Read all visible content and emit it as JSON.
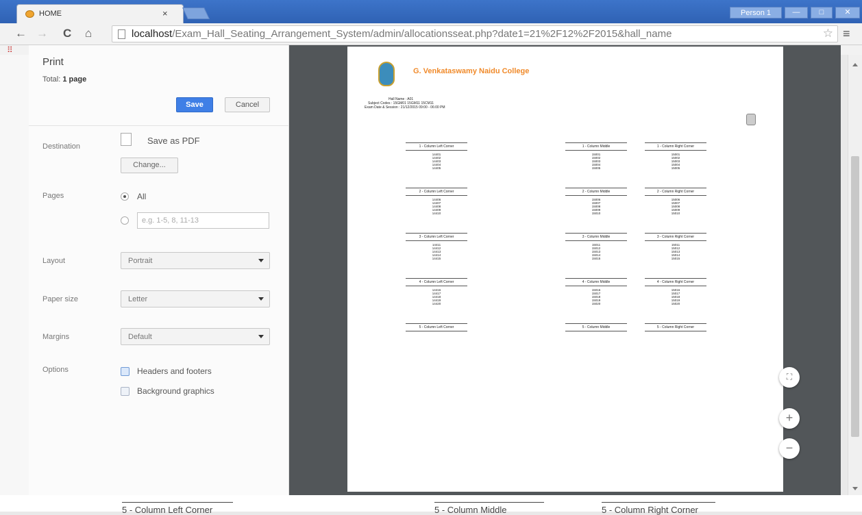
{
  "browser": {
    "tab_title": "HOME",
    "tab_close": "×",
    "profile": "Person 1",
    "min": "—",
    "max": "□",
    "close": "✕",
    "url_host": "localhost",
    "url_path": "/Exam_Hall_Seating_Arrangement_System/admin/allocationsseat.php?date1=21%2F12%2F2015&hall_name"
  },
  "print": {
    "title": "Print",
    "total_label": "Total: ",
    "total_value": "1 page",
    "save": "Save",
    "cancel": "Cancel",
    "destination_label": "Destination",
    "destination_value": "Save as PDF",
    "change": "Change...",
    "pages_label": "Pages",
    "pages_all": "All",
    "pages_placeholder": "e.g. 1-5, 8, 11-13",
    "layout_label": "Layout",
    "layout_value": "Portrait",
    "paper_label": "Paper size",
    "paper_value": "Letter",
    "margins_label": "Margins",
    "margins_value": "Default",
    "options_label": "Options",
    "opt_headers": "Headers and footers",
    "opt_background": "Background graphics"
  },
  "doc": {
    "college": "G. Venkataswamy Naidu College",
    "hall_line": "Hall Name   :   A01",
    "subject_line": "Subject Codes   :   15GM01 15GM11 15CM11",
    "exam_line": "Exam Date & Session   :   21/12/2015 09:00 - 06:00 PM",
    "rows": [
      {
        "left": "1 - Column Left Corner",
        "mid": "1 - Column Middle",
        "right": "1 - Column Right Corner",
        "lnums": "14401\n14402\n14403\n14404\n14405",
        "mnums": "15001\n15002\n15003\n15004\n15005",
        "rnums": "15001\n15002\n15003\n15004\n15005"
      },
      {
        "left": "2 - Column Left Corner",
        "mid": "2 - Column Middle",
        "right": "2 - Column Right Corner",
        "lnums": "14406\n14407\n14408\n14409\n14410",
        "mnums": "15006\n15007\n15008\n15009\n15010",
        "rnums": "15006\n15007\n15008\n15009\n15010"
      },
      {
        "left": "3 - Column Left Corner",
        "mid": "3 - Column Middle",
        "right": "3 - Column Right Corner",
        "lnums": "14411\n14412\n14413\n14414\n14415",
        "mnums": "15011\n15012\n15013\n15014\n15015",
        "rnums": "15011\n15012\n15013\n15014\n15015"
      },
      {
        "left": "4 - Column Left Corner",
        "mid": "4 - Column Middle",
        "right": "4 - Column Right Corner",
        "lnums": "14416\n14417\n14418\n14419\n14420",
        "mnums": "15016\n15017\n15018\n15019\n15020",
        "rnums": "15016\n15017\n15018\n15019\n15020"
      },
      {
        "left": "5 - Column Left Corner",
        "mid": "5 - Column Middle",
        "right": "5 - Column Right Corner",
        "lnums": "",
        "mnums": "",
        "rnums": ""
      }
    ]
  },
  "zoom": {
    "fit": "⛶",
    "in": "+",
    "out": "−"
  },
  "behind": {
    "left": "5 - Column Left Corner",
    "mid": "5 - Column Middle",
    "right": "5 - Column Right Corner"
  }
}
